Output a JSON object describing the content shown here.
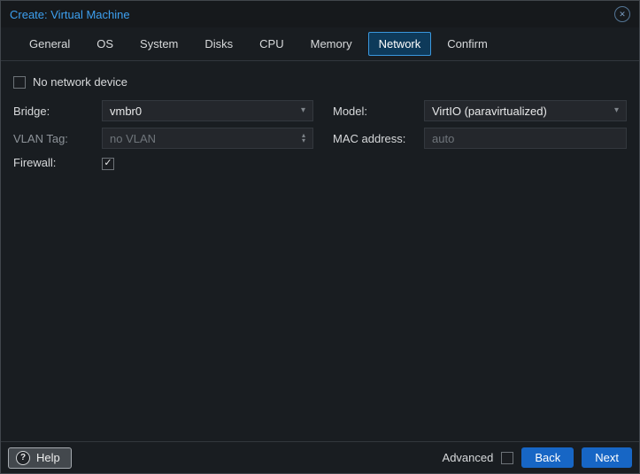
{
  "window": {
    "title": "Create: Virtual Machine",
    "close_glyph": "✕"
  },
  "tabs": [
    {
      "label": "General"
    },
    {
      "label": "OS"
    },
    {
      "label": "System"
    },
    {
      "label": "Disks"
    },
    {
      "label": "CPU"
    },
    {
      "label": "Memory"
    },
    {
      "label": "Network",
      "active": true
    },
    {
      "label": "Confirm"
    }
  ],
  "form": {
    "no_network_device": {
      "label": "No network device",
      "checked": false
    },
    "bridge": {
      "label": "Bridge:",
      "value": "vmbr0"
    },
    "vlan_tag": {
      "label": "VLAN Tag:",
      "placeholder": "no VLAN"
    },
    "firewall": {
      "label": "Firewall:",
      "checked": true
    },
    "model": {
      "label": "Model:",
      "value": "VirtIO (paravirtualized)"
    },
    "mac_address": {
      "label": "MAC address:",
      "placeholder": "auto"
    }
  },
  "footer": {
    "help": "Help",
    "advanced": "Advanced",
    "advanced_checked": false,
    "back": "Back",
    "next": "Next"
  },
  "icons": {
    "help_glyph": "?",
    "check_glyph": "✓",
    "caret_down": "▾",
    "caret_up": "▴"
  },
  "colors": {
    "title_blue": "#3da0f0",
    "active_tab_border": "#3a97dd",
    "active_tab_bg": "#0e3a5a",
    "button_blue": "#1766c5",
    "background": "#191d21"
  }
}
